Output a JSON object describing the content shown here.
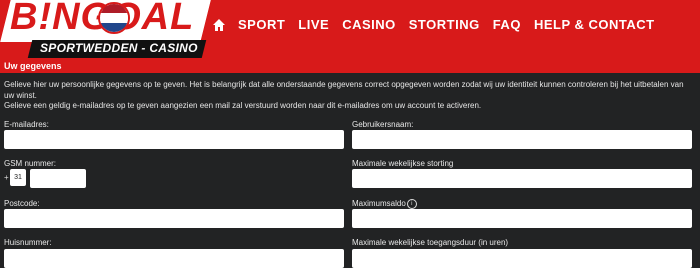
{
  "brand": {
    "logo_text": "B!NGOAL",
    "tagline": "SPORTWEDDEN - CASINO"
  },
  "nav": {
    "items": [
      "SPORT",
      "LIVE",
      "CASINO",
      "STORTING",
      "FAQ",
      "HELP & CONTACT"
    ]
  },
  "section": {
    "title": "Uw gegevens"
  },
  "intro": {
    "line1": "Gelieve hier uw persoonlijke gegevens op te geven. Het is belangrijk dat alle onderstaande gegevens correct opgegeven worden zodat wij uw identiteit kunnen controleren bij het uitbetalen van uw winst.",
    "line2": "Gelieve een geldig e-mailadres op te geven aangezien een mail zal verstuurd worden naar dit e-mailadres om uw account te activeren."
  },
  "form": {
    "email_label": "E-mailadres:",
    "username_label": "Gebruikersnaam:",
    "gsm_label": "GSM nummer:",
    "gsm_prefix": "+",
    "country_code": "31",
    "max_deposit_label": "Maximale wekelijkse storting",
    "postcode_label": "Postcode:",
    "max_balance_label": "Maximumsaldo",
    "info_glyph": "i",
    "housenumber_label": "Huisnummer:",
    "max_access_label": "Maximale wekelijkse toegangsduur (in uren)"
  },
  "colors": {
    "brand_red": "#d81a1a",
    "background": "#222324"
  }
}
